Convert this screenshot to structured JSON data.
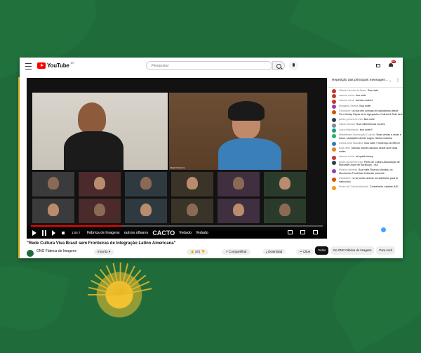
{
  "header": {
    "logo_text": "YouTube",
    "logo_region": "BR",
    "search_placeholder": "Pesquisar",
    "notification_count": "9+"
  },
  "video": {
    "elapsed_time": "1:04:7",
    "progress": 0.31,
    "sponsors": [
      "CACTO",
      "Fábrica de Imagens",
      "outros olhares",
      "Vedado",
      "Vedado"
    ],
    "tiles": [
      {
        "label": ""
      },
      {
        "label": "Beatriz Moreira"
      }
    ]
  },
  "title": "\"Rede Cultura Viva Brasil sem Fronteiras de Integração Latino Americana\"",
  "channel": {
    "name": "ONG Fábrica de Imagens",
    "subscribe_label": "Inscrito",
    "like_count": "34",
    "share_label": "Compartilhar",
    "download_label": "Download",
    "clip_label": "Clipe"
  },
  "chat": {
    "header_title": "Repetição das principais mensagen...",
    "messages": [
      {
        "author": "Vitória Ferreira de Abreu",
        "text": "Boa noite",
        "color": "#c0392b"
      },
      {
        "author": "marcos rocha",
        "text": "boa noite",
        "color": "#c0392b"
      },
      {
        "author": "marcos rocha",
        "text": "buenas noches",
        "color": "#c0392b"
      },
      {
        "author": "Morgana Oliveira",
        "text": "Boa noite!",
        "color": "#8e44ad"
      },
      {
        "author": "ATodoArte",
        "text": "un hoy des compas les saludamos desde Perú Kusisy Reyes de la Agrupacion Cultural A Todo Arte",
        "color": "#d35400"
      },
      {
        "author": "james gomes ferreira",
        "text": "Boa noite",
        "color": "#2c3e50"
      },
      {
        "author": "Gilson Moraes",
        "text": "Boa noite/buenas noches",
        "color": "#7f8c8d"
      },
      {
        "author": "Luiza Historiando",
        "text": "boa noite!!!",
        "color": "#16a085"
      },
      {
        "author": "Metalterrani Associação Cultural",
        "text": "Boas vindas a todas e todos, saudações desde Lagos, Santa Catarina",
        "color": "#27ae60"
      },
      {
        "author": "Carlos José Mansilha",
        "text": "Boa noite; Fronteiriço do BR/UY",
        "color": "#2980b9"
      },
      {
        "author": "Davi Mirlo",
        "text": "buenas noches saludos desde acre boas noites",
        "color": "#e67e22"
      },
      {
        "author": "marcos rocha",
        "text": "ah quello kussy",
        "color": "#c0392b"
      },
      {
        "author": "james gomes ferreira",
        "text": "Ponto de Cultura Associação de Maculelê Urupê de Buriticupu - MA",
        "color": "#2c3e50"
      },
      {
        "author": "Ricardo Almeida",
        "text": "Boa noite Ricardo Almeida, do Movimento Fronteiras Culturais presente.",
        "color": "#8e44ad"
      },
      {
        "author": "ATodoArte",
        "text": "no se puede activar los subtítulos para la traducción",
        "color": "#d35400"
      },
      {
        "author": "Ponto de Cultura Afinando",
        "text": "Conselheiro Lafaiete, MG",
        "color": "#f39c12"
      }
    ]
  },
  "chips": [
    "Todos",
    "De ONG Fábrica de Imagens",
    "Para você"
  ]
}
